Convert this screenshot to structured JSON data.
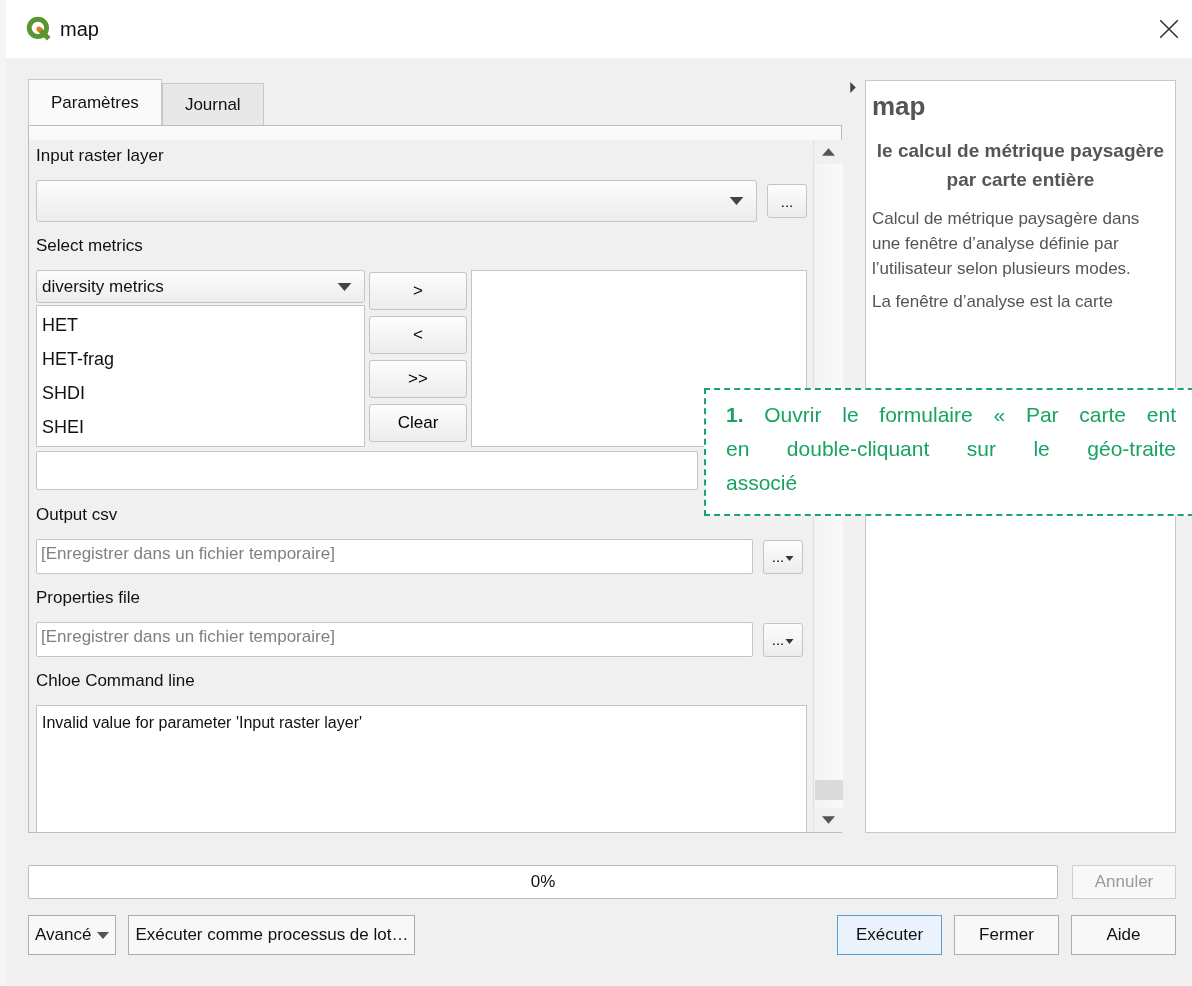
{
  "window": {
    "title": "map"
  },
  "tabs": [
    {
      "label": "Paramètres",
      "selected": true
    },
    {
      "label": "Journal",
      "selected": false
    }
  ],
  "input_raster_layer": {
    "label": "Input raster layer",
    "browse": "..."
  },
  "select_metrics": {
    "label": "Select metrics",
    "category": "diversity metrics",
    "available": [
      "HET",
      "HET-frag",
      "SHDI",
      "SHEI"
    ],
    "buttons": [
      ">",
      "<",
      ">>",
      "Clear"
    ]
  },
  "output_csv": {
    "label": "Output csv",
    "placeholder": "[Enregistrer dans un fichier temporaire]",
    "browse": "..."
  },
  "properties_file": {
    "label": "Properties file",
    "placeholder": "[Enregistrer dans un fichier temporaire]",
    "browse": "..."
  },
  "command_line": {
    "label": "Chloe Command line",
    "value": "Invalid value for parameter 'Input raster layer'"
  },
  "help": {
    "title": "map",
    "heading": "le calcul de métrique paysagère par carte entière",
    "paragraphs": [
      "Calcul de métrique paysagère dans une fenêtre d’analyse définie par l’utilisateur selon plusieurs modes.",
      "La fenêtre d’analyse est la carte"
    ]
  },
  "callout": {
    "lines": [
      "**1.** Ouvrir le formulaire « Par carte ent",
      "en double-cliquant sur le géo-traite",
      "associé"
    ]
  },
  "progress": {
    "level": 0,
    "text": "0%"
  },
  "cancel": {
    "label": "Annuler",
    "disabled": true
  },
  "buttons": [
    {
      "label": "Avancé",
      "kind": "menu"
    },
    {
      "label": "Exécuter comme processus de lot…",
      "kind": "plain"
    },
    {
      "label": "Exécuter",
      "kind": "default"
    },
    {
      "label": "Fermer",
      "kind": "plain"
    },
    {
      "label": "Aide",
      "kind": "plain"
    }
  ]
}
